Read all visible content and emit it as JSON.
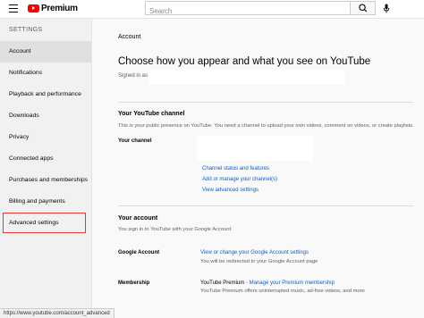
{
  "header": {
    "logo_text": "Premium",
    "search_placeholder": "Search"
  },
  "sidebar": {
    "heading": "SETTINGS",
    "items": [
      {
        "label": "Account"
      },
      {
        "label": "Notifications"
      },
      {
        "label": "Playback and performance"
      },
      {
        "label": "Downloads"
      },
      {
        "label": "Privacy"
      },
      {
        "label": "Connected apps"
      },
      {
        "label": "Purchases and memberships"
      },
      {
        "label": "Billing and payments"
      },
      {
        "label": "Advanced settings"
      }
    ]
  },
  "main": {
    "section_label": "Account",
    "heading": "Choose how you appear and what you see on YouTube",
    "signed_in_label": "Signed in as",
    "channel": {
      "title": "Your YouTube channel",
      "description": "This is your public presence on YouTube. You need a channel to upload your own videos, comment on videos, or create playlists.",
      "your_channel_label": "Your channel",
      "links": [
        "Channel status and features",
        "Add or manage your channel(s)",
        "View advanced settings"
      ]
    },
    "account": {
      "title": "Your account",
      "description": "You sign in to YouTube with your Google Account",
      "google_label": "Google Account",
      "google_link": "View or change your Google Account settings",
      "google_sub": "You will be redirected to your Google Account page",
      "membership_label": "Membership",
      "membership_value": "YouTube Premium",
      "membership_sep": " · ",
      "membership_link": "Manage your Premium membership",
      "membership_sub": "YouTube Premium offers uninterrupted music, ad-free videos, and more"
    }
  },
  "status_bar": {
    "url": "https://www.youtube.com/account_advanced"
  },
  "colors": {
    "brand_red": "#ff0000",
    "link_blue": "#065fd4",
    "highlight_red": "#e53935"
  }
}
